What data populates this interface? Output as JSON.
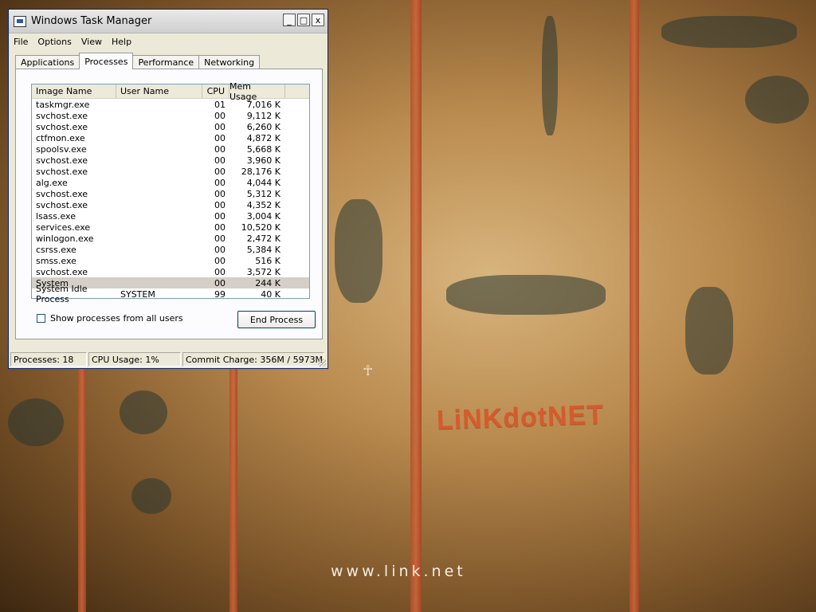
{
  "window": {
    "title": "Windows Task Manager",
    "controls": {
      "minimize": "_",
      "maximize": "□",
      "close": "x"
    }
  },
  "menu": [
    "File",
    "Options",
    "View",
    "Help"
  ],
  "tabs": [
    "Applications",
    "Processes",
    "Performance",
    "Networking"
  ],
  "active_tab": "Processes",
  "columns": [
    "Image Name",
    "User Name",
    "CPU",
    "Mem Usage"
  ],
  "processes": [
    {
      "image": "taskmgr.exe",
      "user": "",
      "cpu": "01",
      "mem": "7,016 K"
    },
    {
      "image": "svchost.exe",
      "user": "",
      "cpu": "00",
      "mem": "9,112 K"
    },
    {
      "image": "svchost.exe",
      "user": "",
      "cpu": "00",
      "mem": "6,260 K"
    },
    {
      "image": "ctfmon.exe",
      "user": "",
      "cpu": "00",
      "mem": "4,872 K"
    },
    {
      "image": "spoolsv.exe",
      "user": "",
      "cpu": "00",
      "mem": "5,668 K"
    },
    {
      "image": "svchost.exe",
      "user": "",
      "cpu": "00",
      "mem": "3,960 K"
    },
    {
      "image": "svchost.exe",
      "user": "",
      "cpu": "00",
      "mem": "28,176 K"
    },
    {
      "image": "alg.exe",
      "user": "",
      "cpu": "00",
      "mem": "4,044 K"
    },
    {
      "image": "svchost.exe",
      "user": "",
      "cpu": "00",
      "mem": "5,312 K"
    },
    {
      "image": "svchost.exe",
      "user": "",
      "cpu": "00",
      "mem": "4,352 K"
    },
    {
      "image": "lsass.exe",
      "user": "",
      "cpu": "00",
      "mem": "3,004 K"
    },
    {
      "image": "services.exe",
      "user": "",
      "cpu": "00",
      "mem": "10,520 K"
    },
    {
      "image": "winlogon.exe",
      "user": "",
      "cpu": "00",
      "mem": "2,472 K"
    },
    {
      "image": "csrss.exe",
      "user": "",
      "cpu": "00",
      "mem": "5,384 K"
    },
    {
      "image": "smss.exe",
      "user": "",
      "cpu": "00",
      "mem": "516 K"
    },
    {
      "image": "svchost.exe",
      "user": "",
      "cpu": "00",
      "mem": "3,572 K"
    },
    {
      "image": "System",
      "user": "",
      "cpu": "00",
      "mem": "244 K"
    },
    {
      "image": "System Idle Process",
      "user": "SYSTEM",
      "cpu": "99",
      "mem": "40 K"
    }
  ],
  "selected_row": "System",
  "show_all_users_label": "Show processes from all users",
  "show_all_users_checked": false,
  "end_process_label": "End Process",
  "status": {
    "processes": "Processes: 18",
    "cpu": "CPU Usage: 1%",
    "commit": "Commit Charge: 356M / 5973M"
  },
  "wallpaper": {
    "logo_text": "LiNKdotNET",
    "url_text": "www.link.net",
    "cursor_glyph": "☥"
  },
  "colors": {
    "logo": "#d65a2d",
    "stripe": "#c85d34"
  }
}
